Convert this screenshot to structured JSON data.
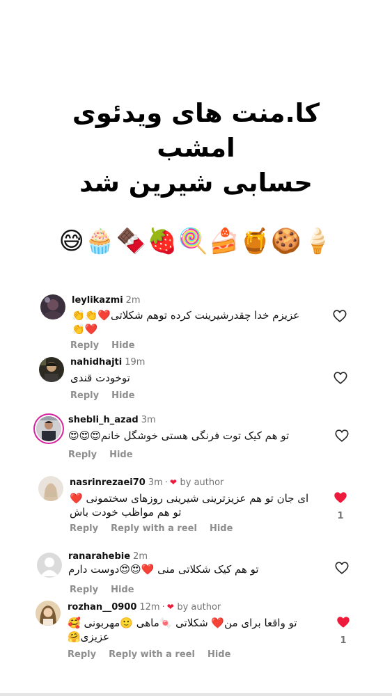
{
  "title": {
    "line1": "کا.منت های ویدئوی",
    "line2": "امشب",
    "line3": "حسابی شیرین شد"
  },
  "emoji_row": "😅🧁🍫🍓🍭🍰🍯🍪🍦",
  "actions": {
    "reply": "Reply",
    "hide": "Hide",
    "reply_with_reel": "Reply with a reel"
  },
  "comments": [
    {
      "username": "leylikazmi",
      "time": "2m",
      "line1": "عزیزم خدا چقدرشیرینت کرده توهم شکلاتی❤️👏👏",
      "line2": "❤️👏",
      "liked": false
    },
    {
      "username": "nahidhajti",
      "time": "19m",
      "line1": "توخودت قندی",
      "liked": false
    },
    {
      "username": "shebli_h_azad",
      "time": "3m",
      "line1": "تو هم کیک توت فرنگی هستی خوشگل خانم😍😍😍",
      "liked": false
    },
    {
      "username": "nasrinrezaei70",
      "time": "3m",
      "by_author": "by author",
      "line1": "ای جان تو هم عزیزترینی شیرینی روزهای سختمونی ❤️",
      "line2": "تو هم مواظب خودت باش",
      "liked": true,
      "like_count": "1"
    },
    {
      "username": "ranarahebie",
      "time": "2m",
      "line1": "تو هم کیک شکلاتی منی ❤️😍😍دوست دارم",
      "liked": false
    },
    {
      "username": "rozhan__0900",
      "time": "12m",
      "by_author": "by author",
      "line1": "تو واقعا برای من❤️ شکلاتی 🍬ماهی 🙂مهربونی 🥰",
      "line2": "عزیزی🤗",
      "liked": true,
      "like_count": "1"
    }
  ],
  "colors": {
    "liked_heart": "#ed1a3b",
    "muted_text": "#737373",
    "story_ring": "#d6249f"
  }
}
